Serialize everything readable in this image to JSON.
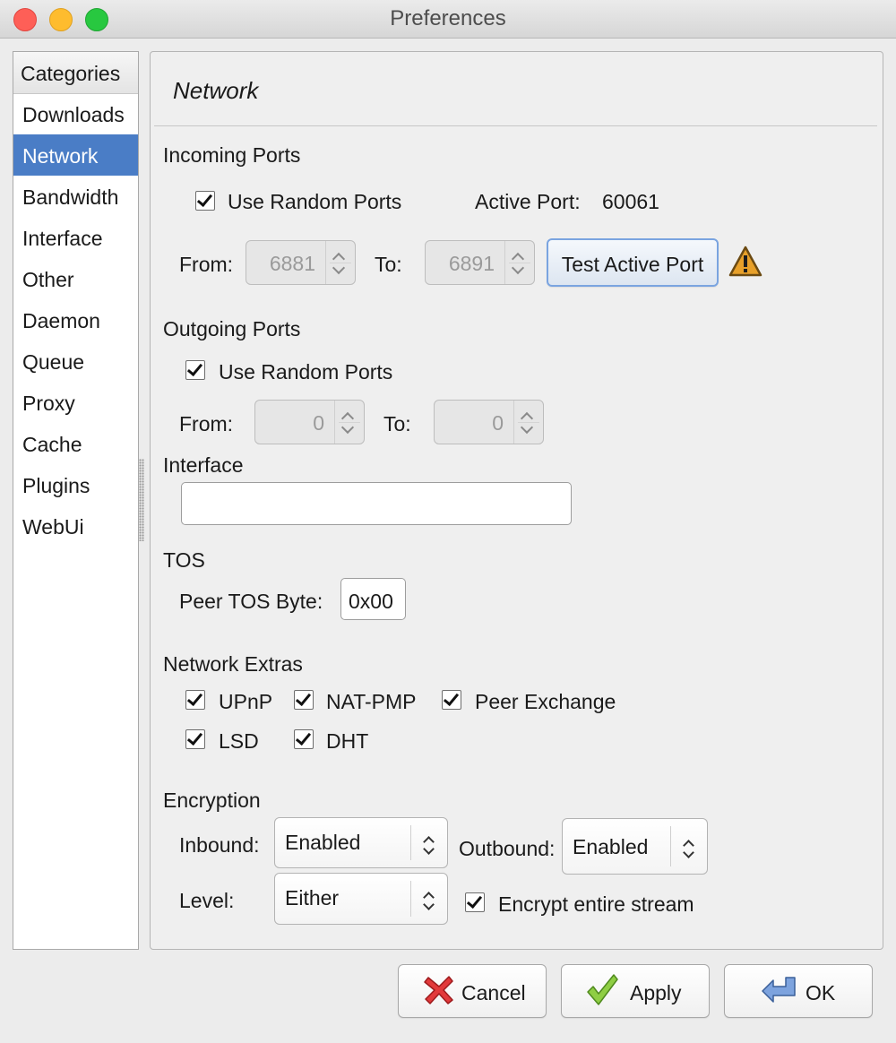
{
  "window": {
    "title": "Preferences",
    "controls": {
      "close_color": "#fe5f57",
      "minimize_color": "#febc2e",
      "zoom_color": "#28c840"
    }
  },
  "sidebar": {
    "header": "Categories",
    "items": [
      {
        "label": "Downloads",
        "selected": false
      },
      {
        "label": "Network",
        "selected": true
      },
      {
        "label": "Bandwidth",
        "selected": false
      },
      {
        "label": "Interface",
        "selected": false
      },
      {
        "label": "Other",
        "selected": false
      },
      {
        "label": "Daemon",
        "selected": false
      },
      {
        "label": "Queue",
        "selected": false
      },
      {
        "label": "Proxy",
        "selected": false
      },
      {
        "label": "Cache",
        "selected": false
      },
      {
        "label": "Plugins",
        "selected": false
      },
      {
        "label": "WebUi",
        "selected": false
      }
    ],
    "selected_color": "#4a7dc6"
  },
  "page": {
    "title": "Network",
    "incoming": {
      "heading": "Incoming Ports",
      "random_label": "Use Random Ports",
      "random_checked": true,
      "active_port_label": "Active Port:",
      "active_port_value": "60061",
      "from_label": "From:",
      "from_value": "6881",
      "to_label": "To:",
      "to_value": "6891",
      "test_button": "Test Active Port",
      "warning_icon": "warning-icon"
    },
    "outgoing": {
      "heading": "Outgoing Ports",
      "random_label": "Use Random Ports",
      "random_checked": true,
      "from_label": "From:",
      "from_value": "0",
      "to_label": "To:",
      "to_value": "0"
    },
    "interface": {
      "heading": "Interface",
      "value": ""
    },
    "tos": {
      "heading": "TOS",
      "peer_label": "Peer TOS Byte:",
      "peer_value": "0x00"
    },
    "extras": {
      "heading": "Network Extras",
      "upnp": "UPnP",
      "natpmp": "NAT-PMP",
      "pex": "Peer Exchange",
      "lsd": "LSD",
      "dht": "DHT"
    },
    "encryption": {
      "heading": "Encryption",
      "inbound_label": "Inbound:",
      "inbound_value": "Enabled",
      "outbound_label": "Outbound:",
      "outbound_value": "Enabled",
      "level_label": "Level:",
      "level_value": "Either",
      "encrypt_stream_label": "Encrypt entire stream",
      "encrypt_stream_checked": true
    }
  },
  "footer": {
    "cancel": "Cancel",
    "apply": "Apply",
    "ok": "OK"
  }
}
